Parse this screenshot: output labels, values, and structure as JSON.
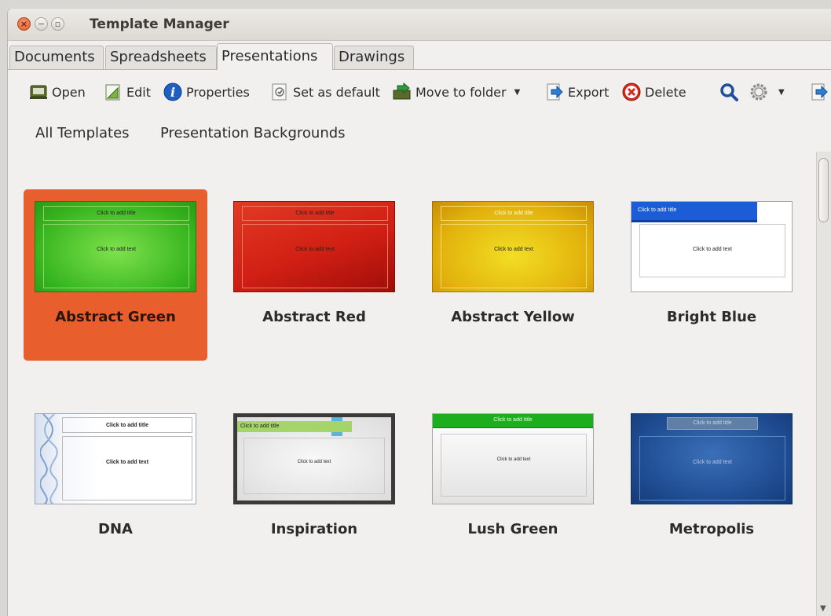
{
  "window": {
    "title": "Template Manager"
  },
  "tabs": [
    {
      "label": "Documents"
    },
    {
      "label": "Spreadsheets"
    },
    {
      "label": "Presentations"
    },
    {
      "label": "Drawings"
    }
  ],
  "toolbar": {
    "open": "Open",
    "edit": "Edit",
    "properties": "Properties",
    "set_default": "Set as default",
    "move_to_folder": "Move to folder",
    "export": "Export",
    "delete": "Delete"
  },
  "folders": [
    {
      "label": "All Templates"
    },
    {
      "label": "Presentation Backgrounds"
    }
  ],
  "templates": [
    {
      "name": "Abstract Green",
      "title_placeholder": "Click to add title",
      "text_placeholder": "Click to add text",
      "selected": true
    },
    {
      "name": "Abstract Red",
      "title_placeholder": "Click to add title",
      "text_placeholder": "Click to add text"
    },
    {
      "name": "Abstract Yellow",
      "title_placeholder": "Click to add title",
      "text_placeholder": "Click to add text"
    },
    {
      "name": "Bright Blue",
      "title_placeholder": "Click to add title",
      "text_placeholder": "Click to add text"
    },
    {
      "name": "DNA",
      "title_placeholder": "Click to add title",
      "text_placeholder": "Click to add text"
    },
    {
      "name": "Inspiration",
      "title_placeholder": "Click to add title",
      "text_placeholder": "Click to add text"
    },
    {
      "name": "Lush Green",
      "title_placeholder": "Click to add title",
      "text_placeholder": "Click to add text"
    },
    {
      "name": "Metropolis",
      "title_placeholder": "Click to add title",
      "text_placeholder": "Click to add text"
    }
  ],
  "colors": {
    "selection": "#e95e2d",
    "window_bg": "#f1f0ee"
  },
  "icons": [
    "close-icon",
    "minimize-icon",
    "maximize-icon",
    "open-icon",
    "edit-icon",
    "properties-icon",
    "set-default-icon",
    "move-to-folder-icon",
    "export-icon",
    "delete-icon",
    "search-icon",
    "settings-icon",
    "repository-icon"
  ]
}
